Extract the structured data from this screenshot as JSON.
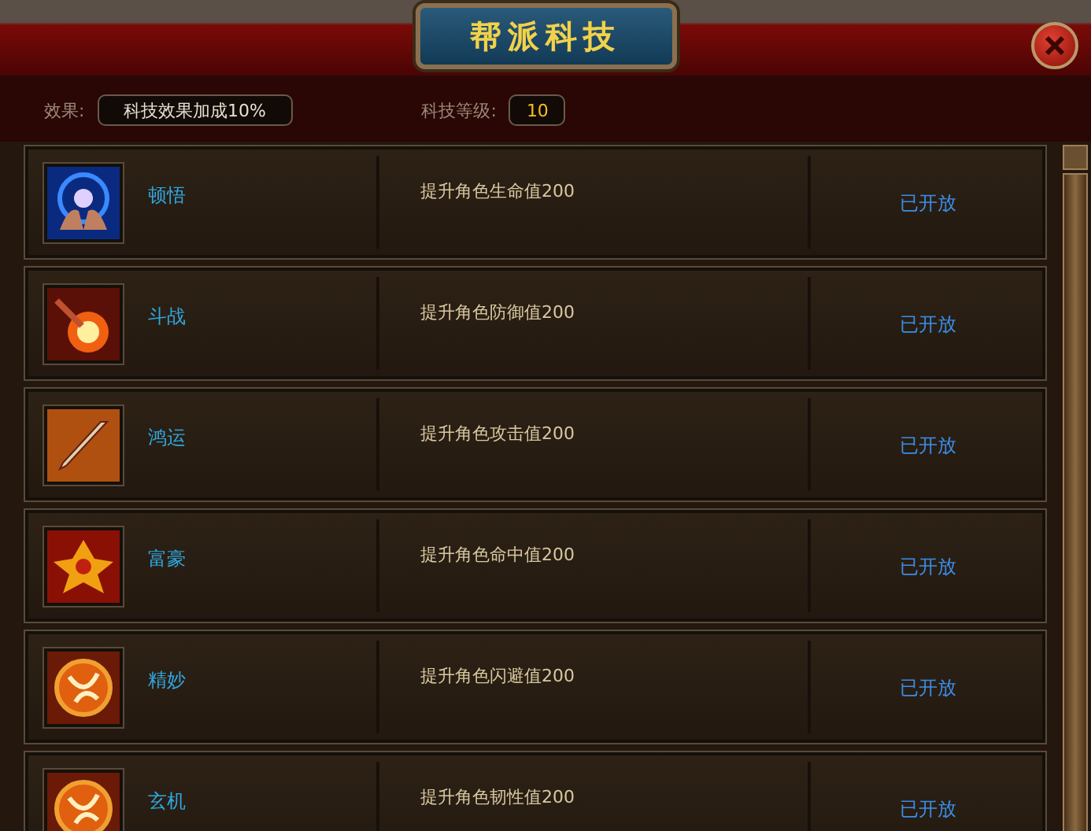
{
  "window": {
    "title": "帮派科技"
  },
  "info": {
    "effect_label": "效果:",
    "effect_value": "科技效果加成10%",
    "level_label": "科技等级:",
    "level_value": "10"
  },
  "techs": [
    {
      "kind": "orb",
      "name": "顿悟",
      "description": "提升角色生命值200",
      "status": "已开放"
    },
    {
      "kind": "blast",
      "name": "斗战",
      "description": "提升角色防御值200",
      "status": "已开放"
    },
    {
      "kind": "blade",
      "name": "鸿运",
      "description": "提升角色攻击值200",
      "status": "已开放"
    },
    {
      "kind": "emblem",
      "name": "富豪",
      "description": "提升角色命中值200",
      "status": "已开放"
    },
    {
      "kind": "swirl",
      "name": "精妙",
      "description": "提升角色闪避值200",
      "status": "已开放"
    },
    {
      "kind": "swirl",
      "name": "玄机",
      "description": "提升角色韧性值200",
      "status": "已开放"
    }
  ]
}
